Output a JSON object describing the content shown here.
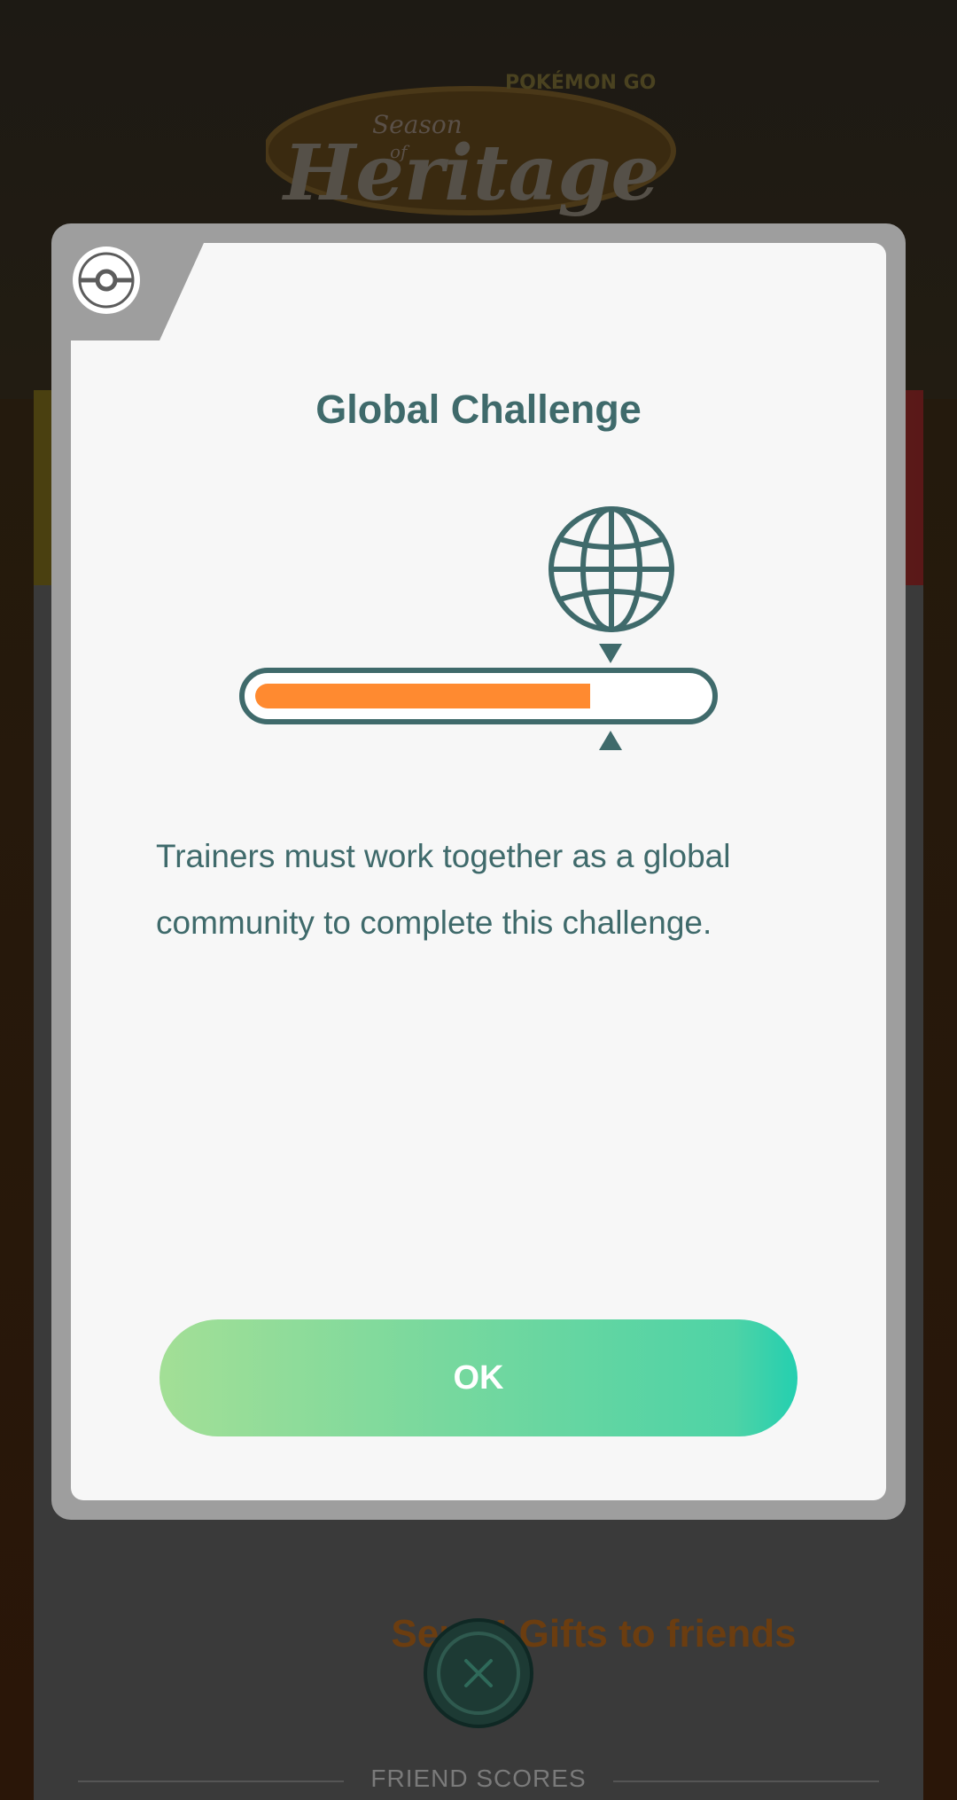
{
  "background": {
    "event_logo": {
      "line1": "Season",
      "line2": "of",
      "line3": "Heritage",
      "brand": "POKÉMON GO"
    },
    "sent_gifts_text": "Sent 4  Gifts to friends",
    "friend_scores_label": "FRIEND SCORES"
  },
  "dialog": {
    "title": "Global Challenge",
    "progress_fraction": 0.75,
    "body": "Trainers must work together as a global community to complete this challenge.",
    "ok_label": "OK",
    "icons": [
      "pokeball-icon",
      "globe-icon",
      "pointer-down-icon",
      "pointer-up-icon",
      "close-icon"
    ]
  },
  "colors": {
    "accent_teal": "#3f6a6b",
    "progress_orange": "#ff8a30",
    "button_gradient_start": "#a3df96",
    "button_gradient_end": "#24cfb0"
  }
}
